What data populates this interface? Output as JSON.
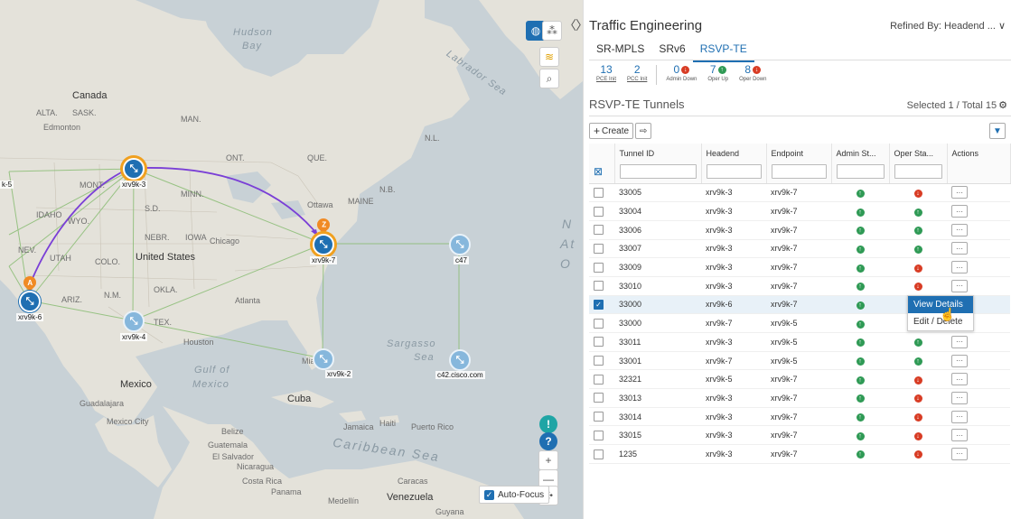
{
  "map": {
    "labels": {
      "hudson": "Hudson",
      "bay": "Bay",
      "canada": "Canada",
      "alta": "ALTA.",
      "sask": "SASK.",
      "edmonton": "Edmonton",
      "us": "United States",
      "mexico": "Mexico",
      "gulf": "Gulf of",
      "gulf2": "Mexico",
      "cuba": "Cuba",
      "sargasso": "Sargasso",
      "sea": "Sea",
      "caribbean": "Caribbean Sea",
      "venezuela": "Venezuela",
      "ottawa": "Ottawa",
      "chicago": "Chicago",
      "houston": "Houston",
      "atlanta": "Atlanta",
      "labrador": "Labrador Sea",
      "atl1": "N",
      "atl2": "At",
      "atl3": "O",
      "montana": "MONT.",
      "idaho": "IDAHO",
      "wyo": "WYO.",
      "utah": "UTAH",
      "colo": "COLO.",
      "nev": "NEV.",
      "ariz": "ARIZ.",
      "nm": "N.M.",
      "tex": "TEX.",
      "okla": "OKLA.",
      "nebr": "NEBR.",
      "iowa": "IOWA",
      "sd": "S.D.",
      "minn": "MINN.",
      "ont": "ONT.",
      "que": "QUE.",
      "maine": "MAINE",
      "nb": "N.B.",
      "nl": "N.L.",
      "mexicocity": "Mexico City",
      "guadalajara": "Guadalajara",
      "caracas": "Caracas",
      "medellin": "Medellín",
      "guyana": "Guyana",
      "puertorico": "Puerto Rico",
      "jamaica": "Jamaica",
      "haiti": "Haiti",
      "guatemala": "Guatemala",
      "belize": "Belize",
      "nicaragua": "Nicaragua",
      "costarica": "Costa Rica",
      "panama": "Panama",
      "miami": "Miami",
      "elsalvador": "El Salvador"
    },
    "nodes": {
      "xrv9k3": "xrv9k-3",
      "xrv9k6": "xrv9k-6",
      "xrv9k7": "xrv9k-7",
      "xrv9k4": "xrv9k-4",
      "xrv9k2": "xrv9k-2",
      "c47": "c47",
      "c42": "c42.cisco.com",
      "left_partial": "k-5"
    },
    "pins": {
      "a": "A",
      "z": "Z"
    },
    "auto_focus_label": "Auto-Focus",
    "controls": {
      "help": "?",
      "plus": "+",
      "minus": "—"
    }
  },
  "panel": {
    "title": "Traffic Engineering",
    "refined_by": "Refined By: Headend ... ∨",
    "tabs": [
      {
        "label": "SR-MPLS"
      },
      {
        "label": "SRv6"
      },
      {
        "label": "RSVP-TE"
      }
    ],
    "stats": {
      "pce_init": {
        "value": "13",
        "label": "PCE Init"
      },
      "pcc_init": {
        "value": "2",
        "label": "PCC Init"
      },
      "admin_down": {
        "value": "0",
        "label": "Admin Down"
      },
      "oper_up": {
        "value": "7",
        "label": "Oper Up"
      },
      "oper_down": {
        "value": "8",
        "label": "Oper Down"
      }
    },
    "section_title": "RSVP-TE Tunnels",
    "selected_total": "Selected 1 / Total 15",
    "create_label": "Create",
    "columns": {
      "tunnel_id": "Tunnel ID",
      "headend": "Headend",
      "endpoint": "Endpoint",
      "admin": "Admin St...",
      "oper": "Oper Sta...",
      "actions": "Actions"
    },
    "rows": [
      {
        "id": "33005",
        "headend": "xrv9k-3",
        "endpoint": "xrv9k-7",
        "admin": "up",
        "oper": "down",
        "checked": false
      },
      {
        "id": "33004",
        "headend": "xrv9k-3",
        "endpoint": "xrv9k-7",
        "admin": "up",
        "oper": "up",
        "checked": false
      },
      {
        "id": "33006",
        "headend": "xrv9k-3",
        "endpoint": "xrv9k-7",
        "admin": "up",
        "oper": "up",
        "checked": false
      },
      {
        "id": "33007",
        "headend": "xrv9k-3",
        "endpoint": "xrv9k-7",
        "admin": "up",
        "oper": "up",
        "checked": false
      },
      {
        "id": "33009",
        "headend": "xrv9k-3",
        "endpoint": "xrv9k-7",
        "admin": "up",
        "oper": "down",
        "checked": false
      },
      {
        "id": "33010",
        "headend": "xrv9k-3",
        "endpoint": "xrv9k-7",
        "admin": "up",
        "oper": "down",
        "checked": false
      },
      {
        "id": "33000",
        "headend": "xrv9k-6",
        "endpoint": "xrv9k-7",
        "admin": "up",
        "oper": "up",
        "checked": true
      },
      {
        "id": "33000",
        "headend": "xrv9k-7",
        "endpoint": "xrv9k-5",
        "admin": "up",
        "oper": "up",
        "checked": false
      },
      {
        "id": "33011",
        "headend": "xrv9k-3",
        "endpoint": "xrv9k-5",
        "admin": "up",
        "oper": "up",
        "checked": false
      },
      {
        "id": "33001",
        "headend": "xrv9k-7",
        "endpoint": "xrv9k-5",
        "admin": "up",
        "oper": "up",
        "checked": false
      },
      {
        "id": "32321",
        "headend": "xrv9k-5",
        "endpoint": "xrv9k-7",
        "admin": "up",
        "oper": "down",
        "checked": false
      },
      {
        "id": "33013",
        "headend": "xrv9k-3",
        "endpoint": "xrv9k-7",
        "admin": "up",
        "oper": "down",
        "checked": false
      },
      {
        "id": "33014",
        "headend": "xrv9k-3",
        "endpoint": "xrv9k-7",
        "admin": "up",
        "oper": "down",
        "checked": false
      },
      {
        "id": "33015",
        "headend": "xrv9k-3",
        "endpoint": "xrv9k-7",
        "admin": "up",
        "oper": "down",
        "checked": false
      },
      {
        "id": "1235",
        "headend": "xrv9k-3",
        "endpoint": "xrv9k-7",
        "admin": "up",
        "oper": "down",
        "checked": false
      }
    ],
    "context_menu": {
      "view_details": "View Details",
      "edit_delete": "Edit / Delete"
    }
  },
  "colors": {
    "accent": "#1f6fb2",
    "status_up": "#2f9a55",
    "status_down": "#d83c24",
    "pin": "#f08a24"
  }
}
